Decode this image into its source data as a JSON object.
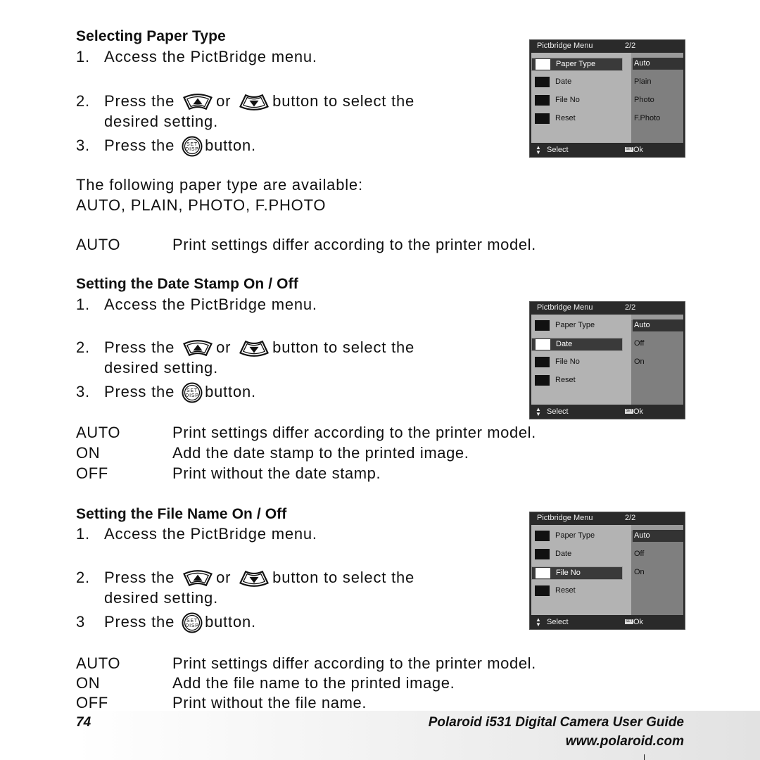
{
  "sections": [
    {
      "heading": "Selecting Paper Type",
      "steps": [
        {
          "num": "1.",
          "text": "Access the PictBridge menu."
        },
        {
          "num": "2.",
          "pre": "Press the",
          "mid": "or",
          "post": "button to select the",
          "cont": "desired setting."
        },
        {
          "num": "3.",
          "pre": "Press the",
          "post": "button."
        }
      ],
      "menu": {
        "title": "Pictbridge Menu",
        "page": "2/2",
        "items": [
          "Paper Type",
          "Date",
          "File No",
          "Reset"
        ],
        "selected_item": 0,
        "options": [
          "Auto",
          "Plain",
          "Photo",
          "F.Photo"
        ],
        "selected_option": 0,
        "footer_select": "Select",
        "footer_set": "SET",
        "footer_ok": "Ok"
      },
      "intro_lines": [
        "The following paper type are available:",
        "AUTO, PLAIN, PHOTO, F.PHOTO"
      ],
      "definitions": [
        {
          "term": "AUTO",
          "def": "Print settings differ according to the printer model."
        }
      ]
    },
    {
      "heading": "Setting the Date Stamp On / Off",
      "steps": [
        {
          "num": "1.",
          "text": "Access the PictBridge menu."
        },
        {
          "num": "2.",
          "pre": "Press the",
          "mid": "or",
          "post": "button to select the",
          "cont": "desired setting."
        },
        {
          "num": "3.",
          "pre": "Press the",
          "post": "button."
        }
      ],
      "menu": {
        "title": "Pictbridge Menu",
        "page": "2/2",
        "items": [
          "Paper Type",
          "Date",
          "File No",
          "Reset"
        ],
        "selected_item": 1,
        "options": [
          "Auto",
          "Off",
          "On"
        ],
        "selected_option": 0,
        "footer_select": "Select",
        "footer_set": "SET",
        "footer_ok": "Ok"
      },
      "definitions": [
        {
          "term": "AUTO",
          "def": "Print settings differ according to the printer model."
        },
        {
          "term": "ON",
          "def": "Add the date stamp to the printed image."
        },
        {
          "term": "OFF",
          "def": "Print without the date stamp."
        }
      ]
    },
    {
      "heading": "Setting the File Name On / Off",
      "steps": [
        {
          "num": "1.",
          "text": "Access the PictBridge menu."
        },
        {
          "num": "2.",
          "pre": "Press the",
          "mid": "or",
          "post": "button to select the",
          "cont": "desired setting."
        },
        {
          "num": "3",
          "pre": "Press the",
          "post": "button."
        }
      ],
      "menu": {
        "title": "Pictbridge Menu",
        "page": "2/2",
        "items": [
          "Paper Type",
          "Date",
          "File No",
          "Reset"
        ],
        "selected_item": 2,
        "options": [
          "Auto",
          "Off",
          "On"
        ],
        "selected_option": 0,
        "footer_select": "Select",
        "footer_set": "SET",
        "footer_ok": "Ok"
      },
      "definitions": [
        {
          "term": "AUTO",
          "def": "Print settings differ according to the printer model."
        },
        {
          "term": "ON",
          "def": "Add the file name to the printed image."
        },
        {
          "term": "OFF",
          "def": "Print without the file name."
        }
      ]
    }
  ],
  "icons": {
    "up_button": "up-arrow-button",
    "down_button": "down-arrow-button",
    "set_button": "set-disp-button",
    "set_button_text_top": "SET",
    "set_button_text_bottom": "DISP"
  },
  "footer": {
    "page_number": "74",
    "guide_title": "Polaroid i531 Digital Camera User Guide",
    "website": "www.polaroid.com"
  }
}
